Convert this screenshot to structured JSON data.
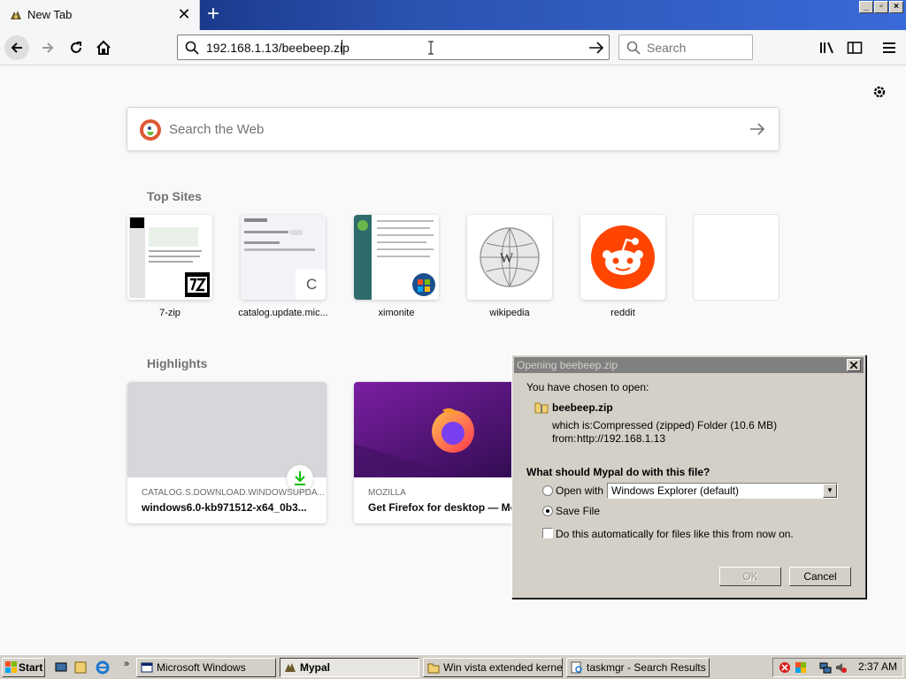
{
  "tabbar": {
    "tab_title": "New Tab",
    "close_glyph": "✕",
    "newtab_glyph": "+"
  },
  "window_controls": {
    "minimize": "_",
    "restore": "▫",
    "close": "×"
  },
  "toolbar": {
    "url": "192.168.1.13/beebeep.zip",
    "search_placeholder": "Search",
    "icons": [
      "back-arrow-icon",
      "forward-arrow-icon",
      "reload-icon",
      "home-icon",
      "library-icon",
      "sidebar-icon",
      "menu-icon"
    ]
  },
  "newtab": {
    "web_search_placeholder": "Search the Web",
    "top_sites_title": "Top Sites",
    "top_sites": [
      {
        "label": "7-zip"
      },
      {
        "label": "catalog.update.mic..."
      },
      {
        "label": "ximonite"
      },
      {
        "label": "wikipedia"
      },
      {
        "label": "reddit"
      }
    ],
    "highlights_title": "Highlights",
    "highlights": [
      {
        "source": "CATALOG.S.DOWNLOAD.WINDOWSUPDA...",
        "title": "windows6.0-kb971512-x64_0b3..."
      },
      {
        "source": "MOZILLA",
        "title": "Get Firefox for desktop — Mo"
      }
    ]
  },
  "dialog": {
    "title": "Opening beebeep.zip",
    "intro": "You have chosen to open:",
    "filename": "beebeep.zip",
    "which_is_label": "which is:",
    "which_is_value": "Compressed (zipped) Folder (10.6 MB)",
    "from_label": "from:",
    "from_value": "http://192.168.1.13",
    "question": "What should Mypal do with this file?",
    "open_with_label": "Open with",
    "open_with_value": "Windows Explorer (default)",
    "save_file_label": "Save File",
    "auto_label": "Do this automatically for files like this from now on.",
    "selected_option": "save",
    "ok_label": "OK",
    "cancel_label": "Cancel"
  },
  "taskbar": {
    "start_label": "Start",
    "tasks": [
      {
        "label": "Microsoft Windows"
      },
      {
        "label": "Mypal"
      },
      {
        "label": "Win vista extended kernel..."
      },
      {
        "label": "taskmgr - Search Results i..."
      }
    ],
    "clock": "2:37 AM"
  },
  "colors": {
    "titlebar_blue": "#0a246a",
    "reddit_orange": "#ff4500",
    "dialog_gray": "#d4d0c8"
  }
}
